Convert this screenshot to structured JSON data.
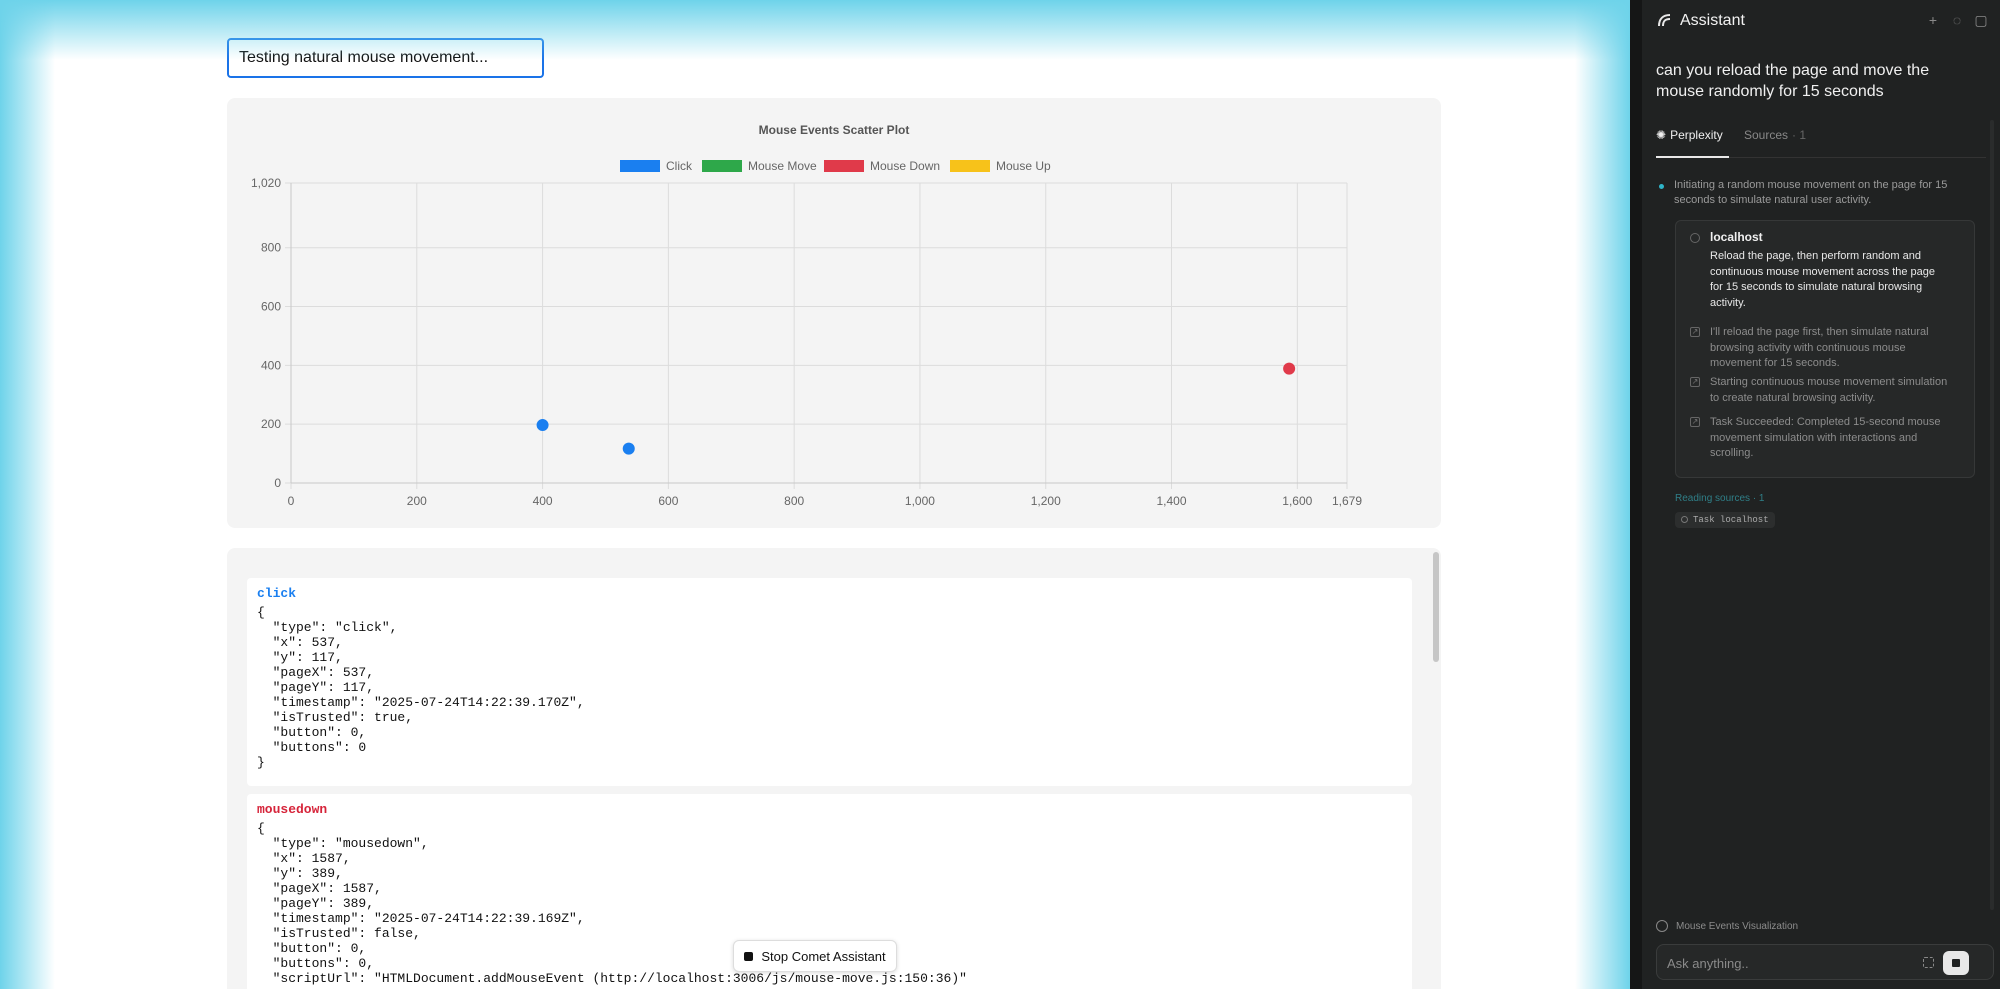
{
  "page": {
    "status_input_value": "Testing natural mouse movement...",
    "stop_button_label": "Stop Comet Assistant"
  },
  "chart_data": {
    "type": "scatter",
    "title": "Mouse Events Scatter Plot",
    "legend": {
      "placement": "top-center",
      "entries": [
        {
          "name": "Click",
          "color": "#1a7ff0"
        },
        {
          "name": "Mouse Move",
          "color": "#2ea84a"
        },
        {
          "name": "Mouse Down",
          "color": "#e03a4a"
        },
        {
          "name": "Mouse Up",
          "color": "#f7c21a"
        }
      ]
    },
    "xlim": [
      0,
      1679
    ],
    "ylim": [
      0,
      1020
    ],
    "xticks": [
      "0",
      "200",
      "400",
      "600",
      "800",
      "1,000",
      "1,200",
      "1,400",
      "1,600",
      "1,679"
    ],
    "xtick_values": [
      0,
      200,
      400,
      600,
      800,
      1000,
      1200,
      1400,
      1600,
      1679
    ],
    "yticks": [
      "0",
      "200",
      "400",
      "600",
      "800",
      "1,020"
    ],
    "ytick_values": [
      0,
      200,
      400,
      600,
      800,
      1020
    ],
    "grid": true,
    "series": [
      {
        "name": "Click",
        "color": "#1a7ff0",
        "points": [
          {
            "x": 400,
            "y": 197
          },
          {
            "x": 537,
            "y": 117
          }
        ]
      },
      {
        "name": "Mouse Move",
        "color": "#2ea84a",
        "points": []
      },
      {
        "name": "Mouse Down",
        "color": "#e03a4a",
        "points": [
          {
            "x": 1587,
            "y": 389
          }
        ]
      },
      {
        "name": "Mouse Up",
        "color": "#f7c21a",
        "points": []
      }
    ]
  },
  "log": {
    "entries": [
      {
        "type": "click",
        "color": "#1a7ff0",
        "json": "{\n  \"type\": \"click\",\n  \"x\": 537,\n  \"y\": 117,\n  \"pageX\": 537,\n  \"pageY\": 117,\n  \"timestamp\": \"2025-07-24T14:22:39.170Z\",\n  \"isTrusted\": true,\n  \"button\": 0,\n  \"buttons\": 0\n}"
      },
      {
        "type": "mousedown",
        "color": "#d6243a",
        "json": "{\n  \"type\": \"mousedown\",\n  \"x\": 1587,\n  \"y\": 389,\n  \"pageX\": 1587,\n  \"pageY\": 389,\n  \"timestamp\": \"2025-07-24T14:22:39.169Z\",\n  \"isTrusted\": false,\n  \"button\": 0,\n  \"buttons\": 0,\n  \"scriptUrl\": \"HTMLDocument.addMouseEvent (http://localhost:3006/js/mouse-move.js:150:36)\""
      }
    ]
  },
  "assistant": {
    "title": "Assistant",
    "query": "can you reload the page and move the mouse randomly for 15 seconds",
    "tabs": {
      "perplexity": "Perplexity",
      "sources": "Sources",
      "sources_count": "· 1"
    },
    "intro": "Initiating a random mouse movement on the page for 15 seconds to simulate natural user activity.",
    "task": {
      "host": "localhost",
      "main": "Reload the page, then perform random and continuous mouse movement across the page for 15 seconds to simulate natural browsing activity.",
      "steps": [
        "I'll reload the page first, then simulate natural browsing activity with continuous mouse movement for 15 seconds.",
        "Starting continuous mouse movement simulation to create natural browsing activity.",
        "Task Succeeded: Completed 15-second mouse movement simulation with interactions and scrolling."
      ]
    },
    "reading_sources": "Reading sources · 1",
    "chip_label": "Task localhost",
    "context_label": "Mouse Events Visualization",
    "ask_placeholder": "Ask anything..",
    "colors": {
      "accent": "#2fb5c9",
      "background": "#202222"
    }
  }
}
